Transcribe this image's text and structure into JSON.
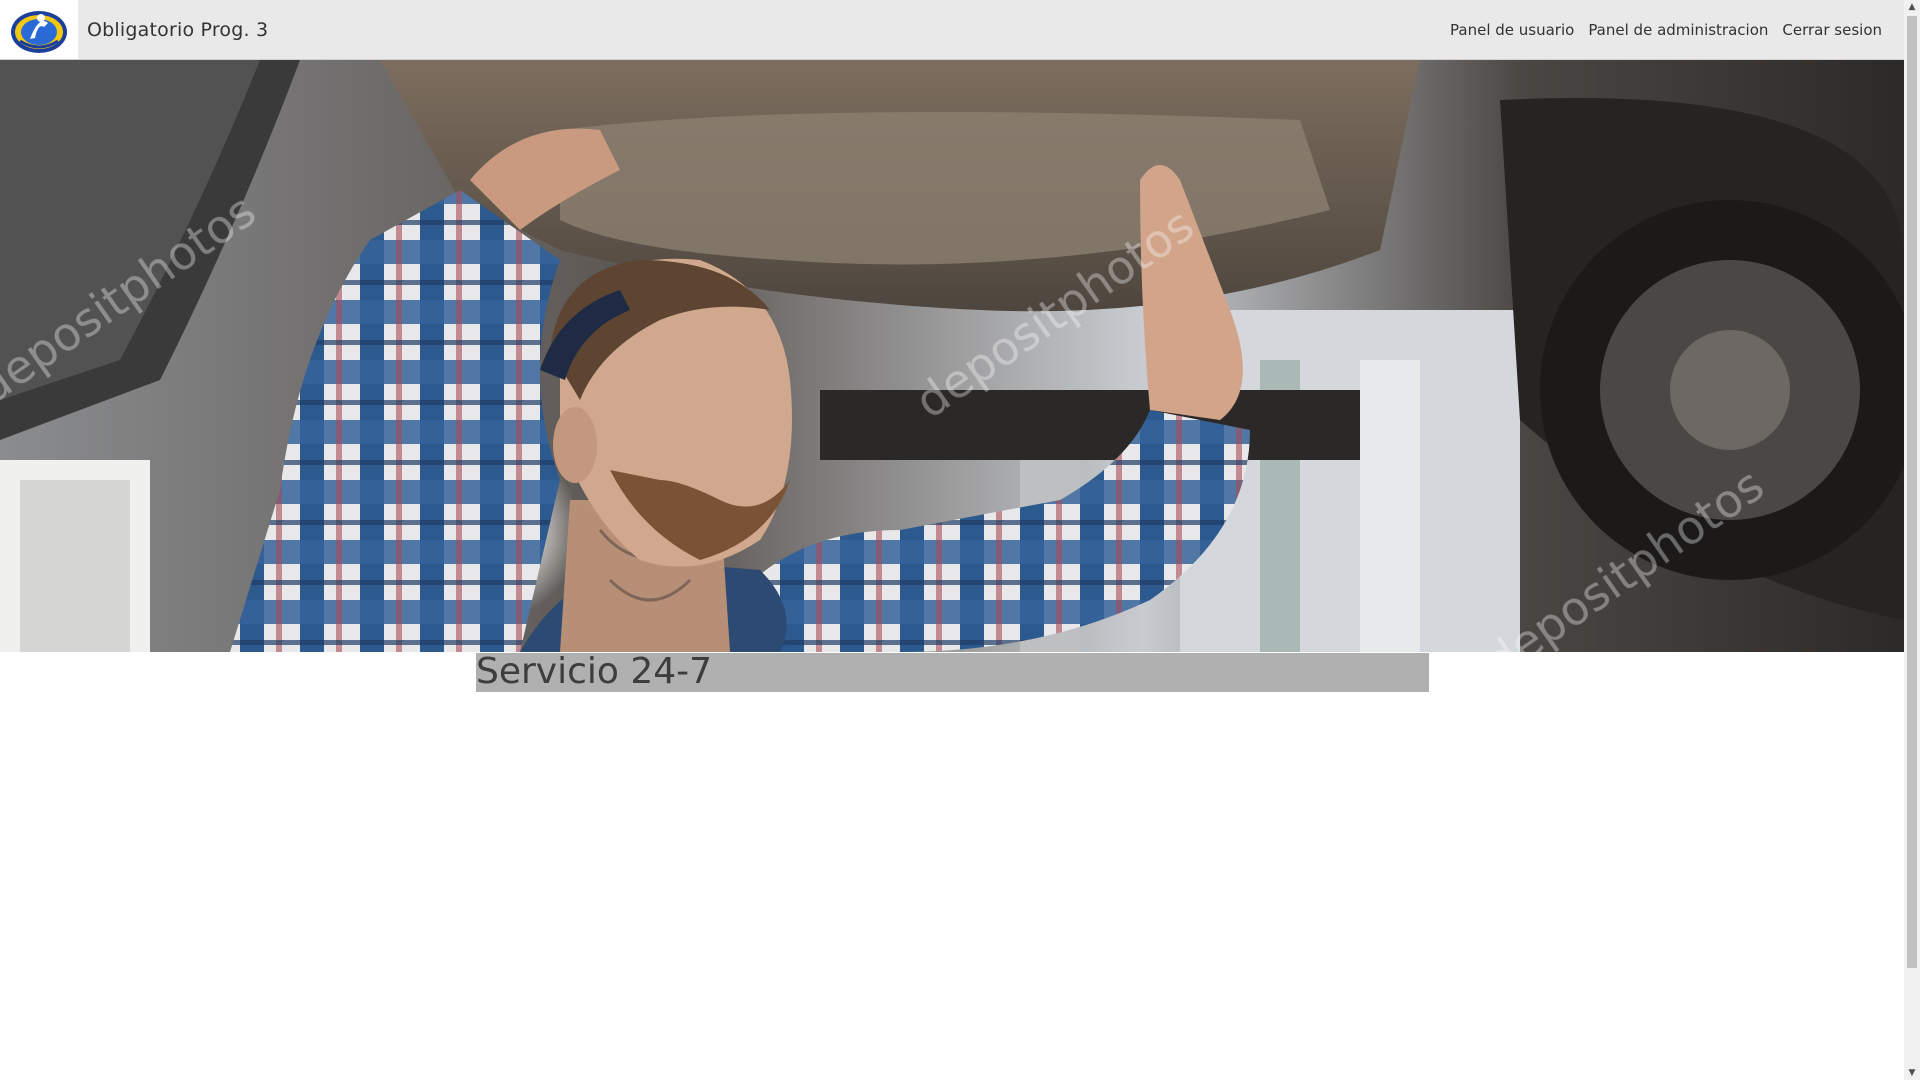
{
  "navbar": {
    "brand": "Obligatorio Prog. 3",
    "links": [
      {
        "label": "Panel de usuario"
      },
      {
        "label": "Panel de administracion"
      },
      {
        "label": "Cerrar sesion"
      }
    ]
  },
  "hero": {
    "icon": "mechanic-under-car-photo"
  },
  "main": {
    "title": "Servicio 24-7"
  },
  "colors": {
    "navbar_bg": "#e9e9e9",
    "title_highlight": "#b0b0b0",
    "text": "#333333"
  }
}
